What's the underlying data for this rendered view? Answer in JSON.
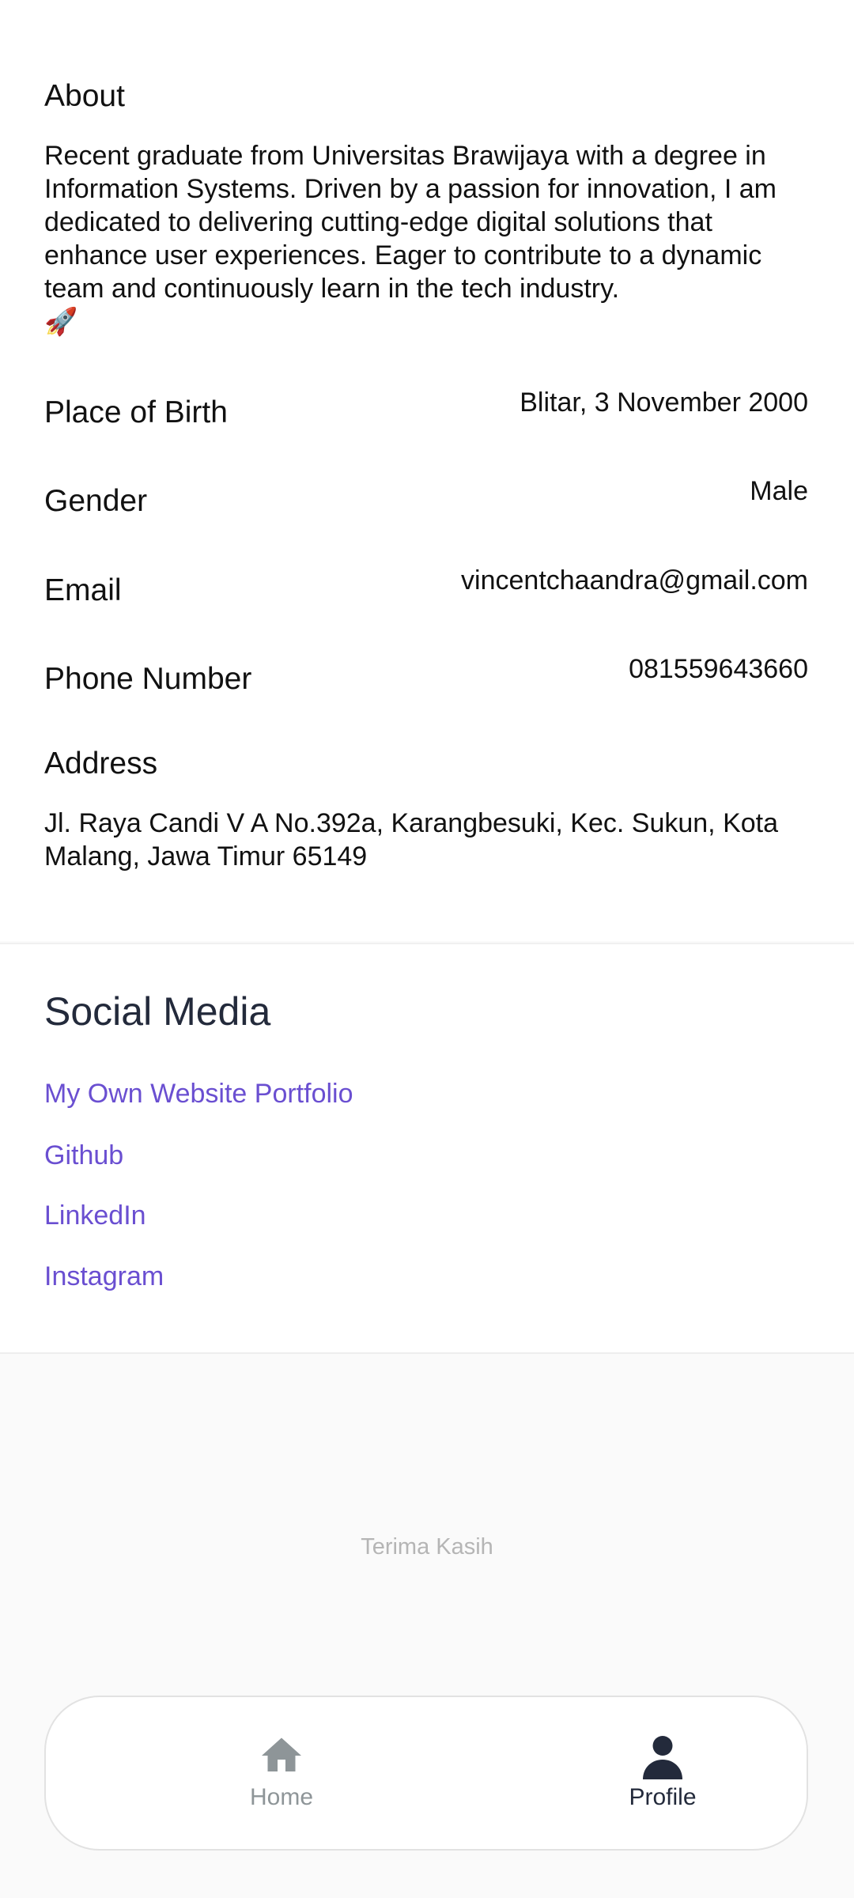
{
  "about": {
    "label": "About",
    "text": "Recent graduate from Universitas Brawijaya with a degree in Information Systems. Driven by a passion for innovation, I am dedicated to delivering cutting-edge digital solutions that enhance user experiences. Eager to contribute to a dynamic team and continuously learn in the tech industry.",
    "emoji": "🚀"
  },
  "info": {
    "place_of_birth": {
      "label": "Place of Birth",
      "value": "Blitar, 3 November 2000"
    },
    "gender": {
      "label": "Gender",
      "value": "Male"
    },
    "email": {
      "label": "Email",
      "value": "vincentchaandra@gmail.com"
    },
    "phone": {
      "label": "Phone Number",
      "value": "081559643660"
    },
    "address": {
      "label": "Address",
      "value": "Jl. Raya Candi V A No.392a, Karangbesuki, Kec. Sukun, Kota Malang, Jawa Timur 65149"
    }
  },
  "social": {
    "title": "Social Media",
    "links": [
      {
        "label": "My Own Website Portfolio"
      },
      {
        "label": "Github"
      },
      {
        "label": "LinkedIn"
      },
      {
        "label": "Instagram"
      }
    ],
    "link_color": "#6a4fd1"
  },
  "footer": {
    "text": "Terima Kasih"
  },
  "bottom_nav": {
    "items": [
      {
        "label": "Home",
        "icon": "home-icon",
        "active": false
      },
      {
        "label": "Profile",
        "icon": "profile-icon",
        "active": true
      }
    ],
    "active_color": "#232a3b",
    "inactive_color": "#8e9598"
  }
}
